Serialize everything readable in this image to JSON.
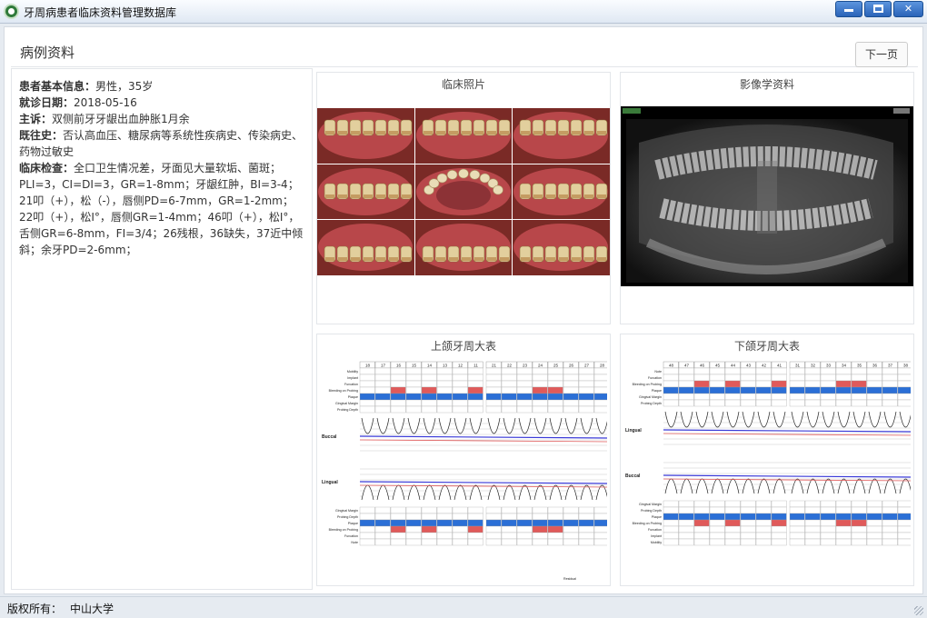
{
  "window": {
    "title": "牙周病患者临床资料管理数据库",
    "controls": [
      "minimize",
      "maximize",
      "close"
    ]
  },
  "header": {
    "title": "病例资料",
    "next_button": "下一页"
  },
  "patient_info": [
    {
      "label": "患者基本信息：",
      "value": "男性，35岁"
    },
    {
      "label": "就诊日期：",
      "value": "2018-05-16"
    },
    {
      "label": "主诉：",
      "value": "双侧前牙牙龈出血肿胀1月余"
    },
    {
      "label": "既往史：",
      "value": "否认高血压、糖尿病等系统性疾病史、传染病史、药物过敏史"
    },
    {
      "label": "临床检查：",
      "value": "全口卫生情况差，牙面见大量软垢、菌斑；PLI=3，CI=DI=3，GR=1-8mm；牙龈红肿，BI=3-4；21叩（+），松（-），唇侧PD=6-7mm，GR=1-2mm；22叩（+），松Ⅰ°，唇侧GR=1-4mm；46叩（+），松Ⅰ°，舌侧GR=6-8mm，FI=3/4；26残根，36缺失，37近中倾斜；余牙PD=2-6mm；"
    }
  ],
  "cards": {
    "photos": {
      "title": "临床照片"
    },
    "xray": {
      "title": "影像学资料"
    },
    "upper_chart": {
      "title": "上颌牙周大表"
    },
    "lower_chart": {
      "title": "下颌牙周大表"
    }
  },
  "upper_chart": {
    "teeth": [
      "18",
      "17",
      "16",
      "15",
      "14",
      "13",
      "12",
      "11",
      "21",
      "22",
      "23",
      "24",
      "25",
      "26",
      "27",
      "28"
    ],
    "top_rows": [
      "Mobility",
      "Implant",
      "Furcation",
      "Bleeding on Probing",
      "Plaque",
      "Gingival Margin",
      "Probing Depth"
    ],
    "bottom_rows": [
      "Gingival Margin",
      "Probing Depth",
      "Plaque",
      "Bleeding on Probing",
      "Furcation",
      "Note"
    ],
    "buccal": "Buccal",
    "lingual": "Lingual",
    "note": "Residual"
  },
  "lower_chart": {
    "teeth": [
      "48",
      "47",
      "46",
      "45",
      "44",
      "43",
      "42",
      "41",
      "31",
      "32",
      "33",
      "34",
      "35",
      "36",
      "37",
      "38"
    ],
    "top_rows": [
      "Note",
      "Furcation",
      "Bleeding on Probing",
      "Plaque",
      "Gingival Margin",
      "Probing Depth"
    ],
    "bottom_rows": [
      "Gingival Margin",
      "Probing Depth",
      "Plaque",
      "Bleeding on Probing",
      "Furcation",
      "Implant",
      "Mobility"
    ],
    "lingual": "Lingual",
    "buccal": "Buccal"
  },
  "footer": {
    "label": "版权所有：",
    "value": "中山大学"
  },
  "colors": {
    "plaque": "#2b6fd6",
    "bleeding": "#e05a5a",
    "gingival_line": "#3a3ad8"
  }
}
